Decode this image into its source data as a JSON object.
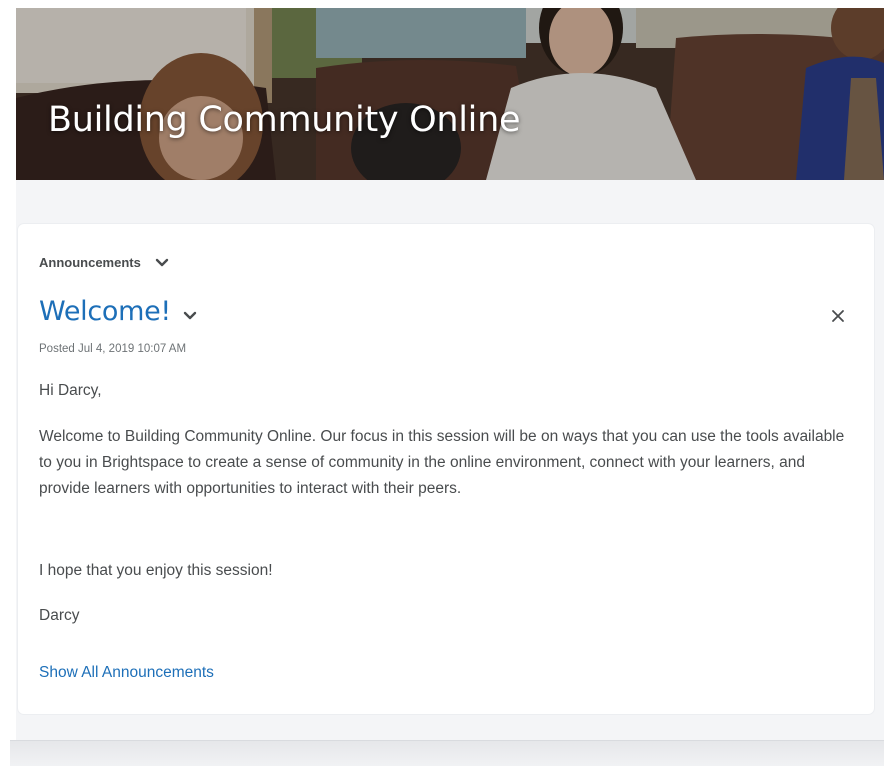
{
  "banner": {
    "title": "Building Community Online"
  },
  "widget": {
    "title": "Announcements",
    "menu_icon": "chevron-down-icon"
  },
  "announcement": {
    "title": "Welcome!",
    "posted": "Posted Jul 4, 2019 10:07 AM",
    "greeting": "Hi Darcy,",
    "paragraph": "Welcome to Building Community Online. Our focus in this session will be on ways that you can use the tools available to you in Brightspace to create a sense of community in the online environment, connect with your learners, and provide learners with opportunities to interact with their peers.",
    "closing": "I hope that you enjoy this session!",
    "signoff": "Darcy",
    "dismiss_icon": "close-icon"
  },
  "footer": {
    "show_all_label": "Show All Announcements"
  },
  "colors": {
    "link": "#1d6fb8",
    "text": "#494c4e",
    "background": "#f4f5f7"
  }
}
